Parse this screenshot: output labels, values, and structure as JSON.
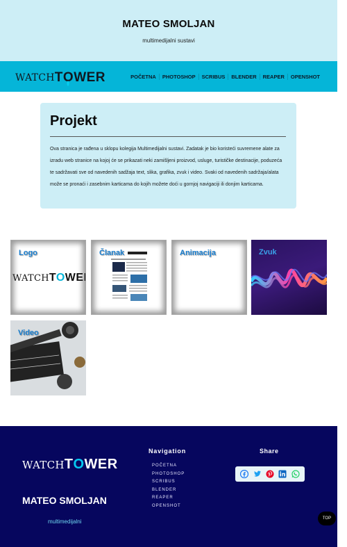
{
  "header": {
    "title": "MATEO SMOLJAN",
    "subtitle": "multimedijalni sustavi"
  },
  "logo": {
    "word1": "WATCH",
    "word2a": "T",
    "word2b": "O",
    "word2c": "WER",
    "icon": "eye-drop-icon"
  },
  "nav": {
    "items": [
      "POČETNA",
      "PHOTOSHOP",
      "SCRIBUS",
      "BLENDER",
      "REAPER",
      "OPENSHOT"
    ]
  },
  "project": {
    "heading": "Projekt",
    "text": "Ova stranica je rađena u sklopu kolegija Multimedijalni sustavi. Zadatak je bio koristeći suvremene alate za izradu web stranice na kojoj će se prikazati neki zamišljeni proizvod, usluge, turističke destinacije, poduzeća te sadržavati sve od navedenih sadžaja text, slika, grafika, zvuk i video. Svaki od navedenih sadržaja/alata može se pronaći i zasebnim karticama do kojih možete doći u gornjoj navigaciji ili donjim karticama."
  },
  "gallery": {
    "tiles": [
      {
        "label": "Logo"
      },
      {
        "label": "Članak"
      },
      {
        "label": "Animacija"
      },
      {
        "label": "Zvuk"
      },
      {
        "label": "Video"
      }
    ]
  },
  "footer": {
    "name": "MATEO SMOLJAN",
    "subtitle": "multimedijalni",
    "nav_heading": "Navigation",
    "nav_items": [
      "POČETNA",
      "PHOTOSHOP",
      "SCRIBUS",
      "BLENDER",
      "REAPER",
      "OPENSHOT"
    ],
    "share_heading": "Share",
    "share_icons": [
      "facebook-icon",
      "twitter-icon",
      "pinterest-icon",
      "linkedin-icon",
      "whatsapp-icon"
    ]
  },
  "top_button": "TOP",
  "colors": {
    "header_bg": "#cdeef6",
    "nav_bg": "#05b5d8",
    "footer_bg": "#06065e",
    "accent_cyan": "#05b5d8"
  }
}
